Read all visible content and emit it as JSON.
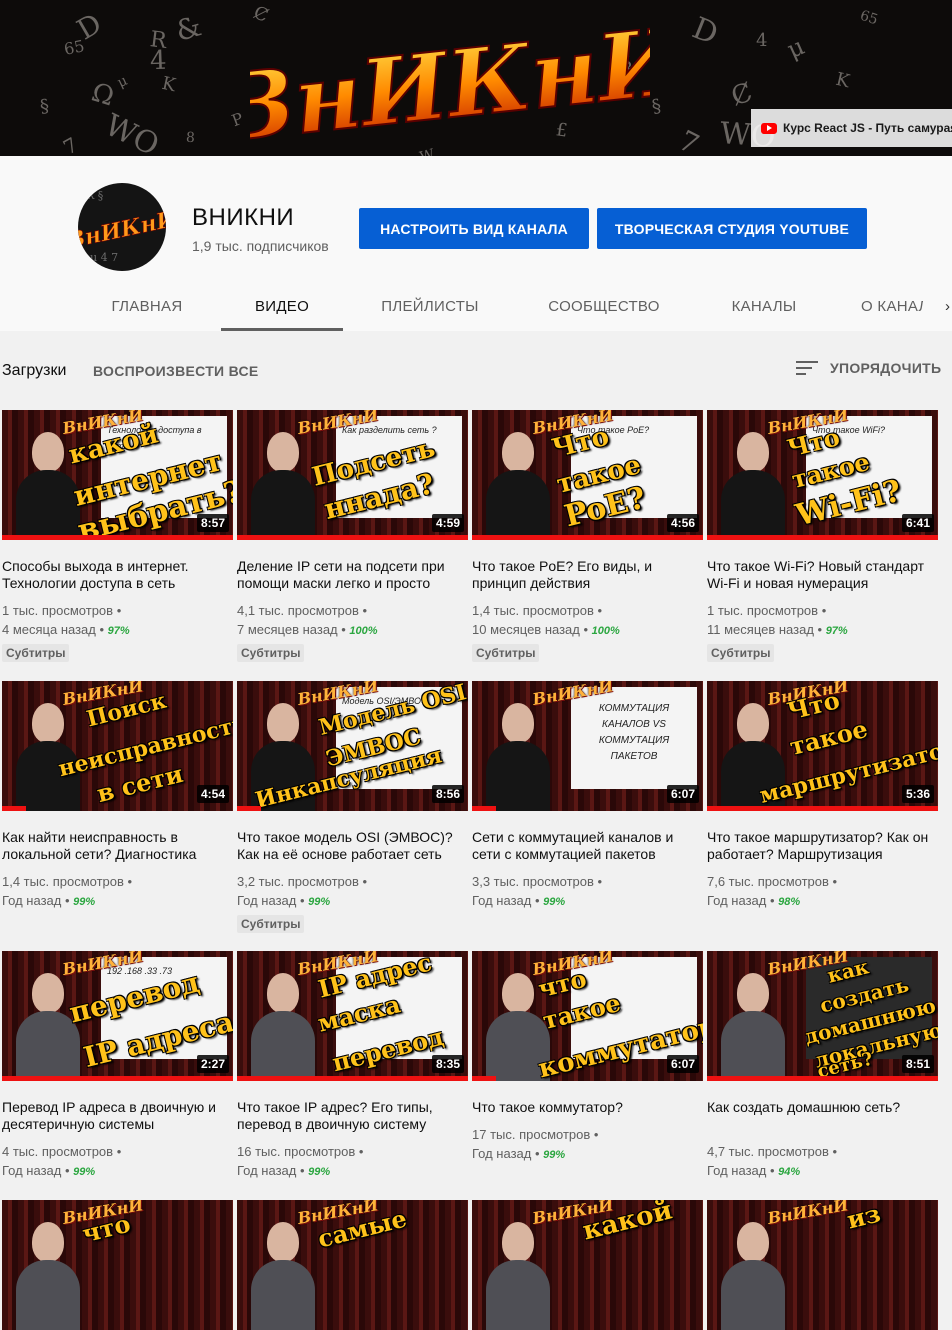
{
  "banner": {
    "logo_text": "ВнИКнИ",
    "glyphs": [
      "D",
      "R",
      "&",
      "Ȼ",
      "4",
      "μ",
      "K",
      "65",
      "WO",
      "8",
      "P",
      "Ω",
      "§",
      "7",
      "£",
      "W",
      "D",
      "4",
      "μ",
      "K",
      "§",
      "7",
      "WO",
      "Ȼ",
      "65",
      "§"
    ],
    "link_text": "Курс React JS - Путь самурая"
  },
  "channel": {
    "name": "ВНИКНИ",
    "subscribers": "1,9 тыс. подписчиков",
    "customize_button": "НАСТРОИТЬ ВИД КАНАЛА",
    "studio_button": "ТВОРЧЕСКАЯ СТУДИЯ YOUTUBE",
    "avatar_text": "ВнИКнИ"
  },
  "tabs": [
    "ГЛАВНАЯ",
    "ВИДЕО",
    "ПЛЕЙЛИСТЫ",
    "СООБЩЕСТВО",
    "КАНАЛЫ",
    "О КАНАЛЕ"
  ],
  "tab_more": "›",
  "uploads": {
    "label": "Загрузки",
    "play_all": "ВОСПРОИЗВЕСТИ ВСЕ",
    "sort": "УПОРЯДОЧИТЬ"
  },
  "subtitles_badge": "Субтитры",
  "videos": [
    {
      "title": "Способы выхода в интернет. Технологии доступа в сеть",
      "views": "1 тыс. просмотров",
      "age": "4 месяца назад",
      "pct": "97%",
      "duration": "8:57",
      "subs": true,
      "thumb_words": [
        "какой",
        "интернет",
        "выбрать?"
      ],
      "panel_text": "Технологии доступа в сеть"
    },
    {
      "title": "Деление IP сети на подсети при помощи маски легко и просто",
      "views": "4,1 тыс. просмотров",
      "age": "7 месяцев назад",
      "pct": "100%",
      "duration": "4:59",
      "subs": true,
      "thumb_words": [
        "Подсеть",
        "ннада?"
      ],
      "panel_text": "Как разделить сеть ?"
    },
    {
      "title": "Что такое PoE? Его виды, и принцип действия",
      "views": "1,4 тыс. просмотров",
      "age": "10 месяцев назад",
      "pct": "100%",
      "duration": "4:56",
      "subs": true,
      "thumb_words": [
        "Что",
        "такое",
        "PoE?"
      ],
      "panel_text": "Что такое PoE?"
    },
    {
      "title": "Что такое Wi-Fi? Новый стандарт Wi-Fi и новая нумерация",
      "views": "1 тыс. просмотров",
      "age": "11 месяцев назад",
      "pct": "97%",
      "duration": "6:41",
      "subs": true,
      "thumb_words": [
        "Что",
        "такое",
        "Wi-Fi?"
      ],
      "panel_text": "Что такое WiFi?"
    },
    {
      "title": "Как найти неисправность в локальной сети? Диагностика",
      "views": "1,4 тыс. просмотров",
      "age": "Год назад",
      "pct": "99%",
      "duration": "4:54",
      "subs": false,
      "thumb_words": [
        "Поиск",
        "неисправности",
        "в сети"
      ],
      "panel_text": ""
    },
    {
      "title": "Что такое модель OSI (ЭМВОС)? Как на её основе работает сеть",
      "views": "3,2 тыс. просмотров",
      "age": "Год назад",
      "pct": "99%",
      "duration": "8:56",
      "subs": true,
      "thumb_words": [
        "Модель OSI",
        "ЭМВОС",
        "Инкапсуляция"
      ],
      "panel_text": "Модель OSI/ЭМВОС"
    },
    {
      "title": "Сети с коммутацией каналов и сети с коммутацией пакетов",
      "views": "3,3 тыс. просмотров",
      "age": "Год назад",
      "pct": "99%",
      "duration": "6:07",
      "subs": false,
      "thumb_words": [],
      "panel_text": "КОММУТАЦИЯ КАНАЛОВ VS КОММУТАЦИЯ ПАКЕТОВ"
    },
    {
      "title": "Что такое маршрутизатор? Как он работает? Маршрутизация",
      "views": "7,6 тыс. просмотров",
      "age": "Год назад",
      "pct": "98%",
      "duration": "5:36",
      "subs": false,
      "thumb_words": [
        "Что",
        "такое",
        "маршрутизатор?"
      ],
      "panel_text": ""
    },
    {
      "title": "Перевод IP адреса в двоичную и десятеричную системы",
      "views": "4 тыс. просмотров",
      "age": "Год назад",
      "pct": "99%",
      "duration": "2:27",
      "subs": false,
      "thumb_words": [
        "перевод",
        "IP адреса"
      ],
      "panel_text": "192 .168 .33 .73"
    },
    {
      "title": "Что такое IP адрес? Его типы, перевод в двоичную систему",
      "views": "16 тыс. просмотров",
      "age": "Год назад",
      "pct": "99%",
      "duration": "8:35",
      "subs": false,
      "thumb_words": [
        "IP адрес",
        "маска",
        "перевод"
      ],
      "panel_text": ""
    },
    {
      "title": "Что такое коммутатор?",
      "views": "17 тыс. просмотров",
      "age": "Год назад",
      "pct": "99%",
      "duration": "6:07",
      "subs": false,
      "thumb_words": [
        "что",
        "такое",
        "коммутатор?"
      ],
      "panel_text": ""
    },
    {
      "title": "Как создать домашнюю сеть?",
      "views": "4,7 тыс. просмотров",
      "age": "Год назад",
      "pct": "94%",
      "duration": "8:51",
      "subs": false,
      "thumb_words": [
        "как",
        "создать",
        "домашнюю",
        "локальную",
        "сеть?"
      ],
      "panel_text": ""
    },
    {
      "title": "",
      "views": "",
      "age": "",
      "pct": "",
      "duration": "",
      "subs": false,
      "thumb_words": [
        "что"
      ],
      "panel_text": ""
    },
    {
      "title": "",
      "views": "",
      "age": "",
      "pct": "",
      "duration": "",
      "subs": false,
      "thumb_words": [
        "самые"
      ],
      "panel_text": ""
    },
    {
      "title": "",
      "views": "",
      "age": "",
      "pct": "",
      "duration": "",
      "subs": false,
      "thumb_words": [
        "какой"
      ],
      "panel_text": ""
    },
    {
      "title": "",
      "views": "",
      "age": "",
      "pct": "",
      "duration": "",
      "subs": false,
      "thumb_words": [
        "из"
      ],
      "panel_text": ""
    }
  ],
  "colors": {
    "accent": "#065fd4",
    "progress": "#ee1111",
    "percent": "#2ba640"
  }
}
